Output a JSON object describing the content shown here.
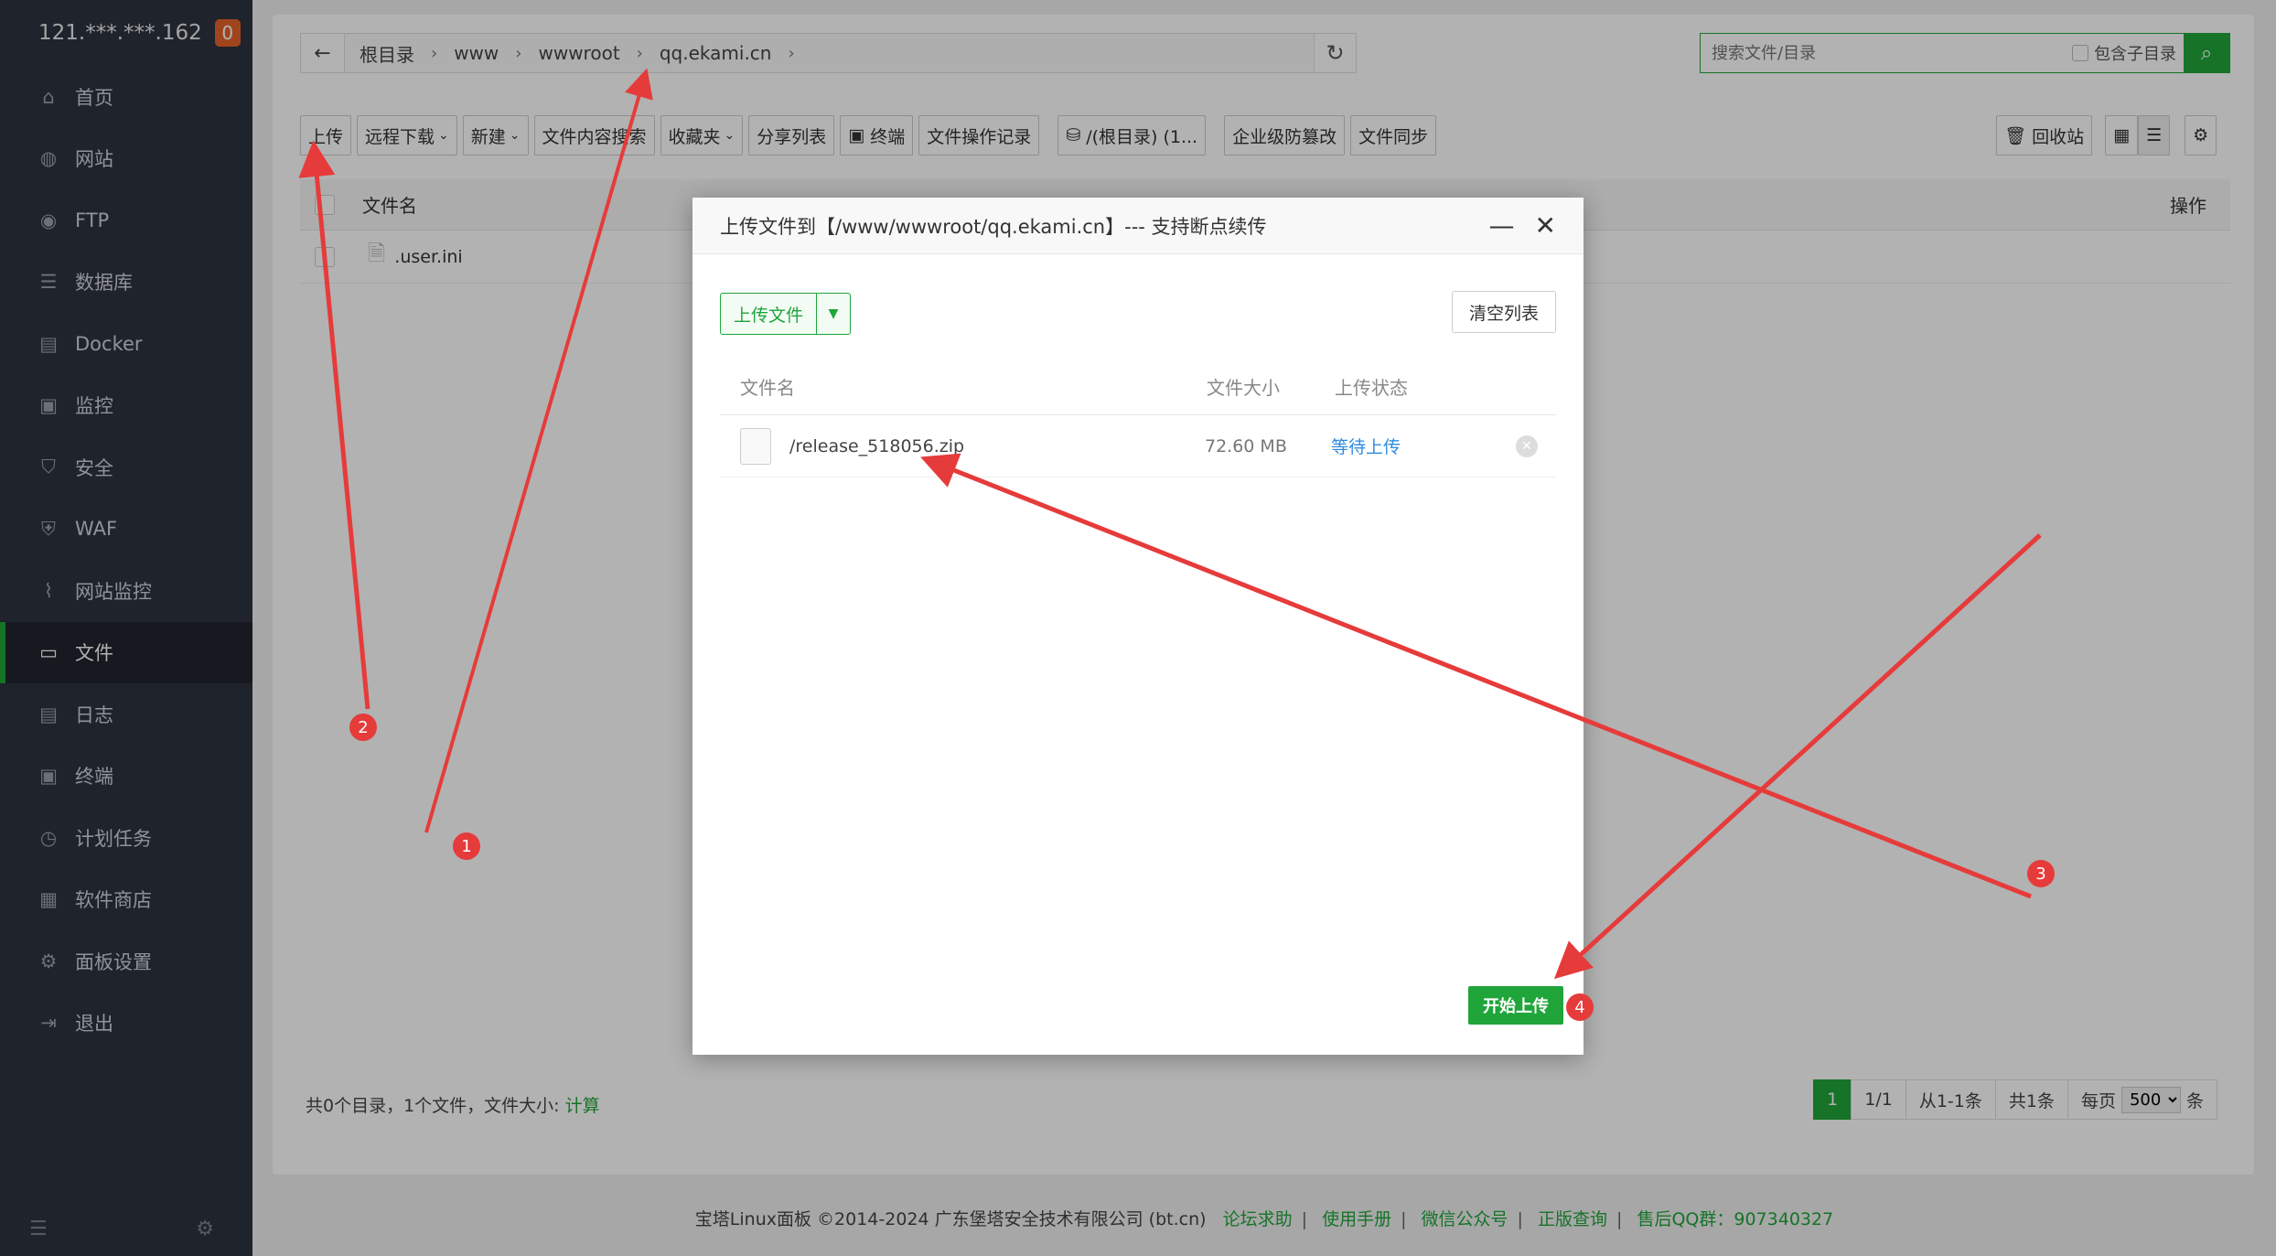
{
  "sidebar": {
    "ip": "121.***.***.162",
    "badge": "0",
    "items": [
      {
        "label": "首页",
        "icon": "home-icon"
      },
      {
        "label": "网站",
        "icon": "globe-icon"
      },
      {
        "label": "FTP",
        "icon": "ftp-icon"
      },
      {
        "label": "数据库",
        "icon": "database-icon"
      },
      {
        "label": "Docker",
        "icon": "docker-icon"
      },
      {
        "label": "监控",
        "icon": "monitor-icon"
      },
      {
        "label": "安全",
        "icon": "shield-icon"
      },
      {
        "label": "WAF",
        "icon": "waf-icon"
      },
      {
        "label": "网站监控",
        "icon": "chart-icon"
      },
      {
        "label": "文件",
        "icon": "folder-icon",
        "active": true
      },
      {
        "label": "日志",
        "icon": "log-icon"
      },
      {
        "label": "终端",
        "icon": "terminal-icon"
      },
      {
        "label": "计划任务",
        "icon": "clock-icon"
      },
      {
        "label": "软件商店",
        "icon": "apps-icon"
      },
      {
        "label": "面板设置",
        "icon": "settings-icon"
      },
      {
        "label": "退出",
        "icon": "logout-icon"
      }
    ]
  },
  "breadcrumb": [
    "根目录",
    "www",
    "wwwroot",
    "qq.ekami.cn"
  ],
  "search": {
    "placeholder": "搜索文件/目录",
    "include_sub": "包含子目录"
  },
  "toolbar": {
    "upload": "上传",
    "remote_download": "远程下载",
    "new": "新建",
    "content_search": "文件内容搜索",
    "favorites": "收藏夹",
    "share_list": "分享列表",
    "terminal": "终端",
    "op_log": "文件操作记录",
    "disk": "/(根目录) (1...",
    "tamper": "企业级防篡改",
    "sync": "文件同步",
    "recycle": "回收站"
  },
  "table": {
    "col_name": "文件名",
    "col_op": "操作",
    "rows": [
      {
        "name": ".user.ini"
      }
    ]
  },
  "footer_info": {
    "text": "共0个目录，1个文件，文件大小: ",
    "link": "计算"
  },
  "pager": {
    "current": "1",
    "total": "1/1",
    "range": "从1-1条",
    "count": "共1条",
    "per_page_label": "每页",
    "per_page": "500",
    "unit": "条"
  },
  "copyright": {
    "text": "宝塔Linux面板 ©2014-2024 广东堡塔安全技术有限公司 (bt.cn)",
    "links": [
      "论坛求助",
      "使用手册",
      "微信公众号",
      "正版查询",
      "售后QQ群：907340327"
    ]
  },
  "dialog": {
    "title": "上传文件到【/www/wwwroot/qq.ekami.cn】--- 支持断点续传",
    "upload_btn": "上传文件",
    "clear_btn": "清空列表",
    "col_name": "文件名",
    "col_size": "文件大小",
    "col_status": "上传状态",
    "file": {
      "name": "/release_518056.zip",
      "size": "72.60 MB",
      "status": "等待上传"
    },
    "start_btn": "开始上传"
  },
  "annotations": [
    "1",
    "2",
    "3",
    "4"
  ],
  "colors": {
    "accent": "#20a53a",
    "arrow": "#e63b3b",
    "sidebar": "#2d333e"
  }
}
